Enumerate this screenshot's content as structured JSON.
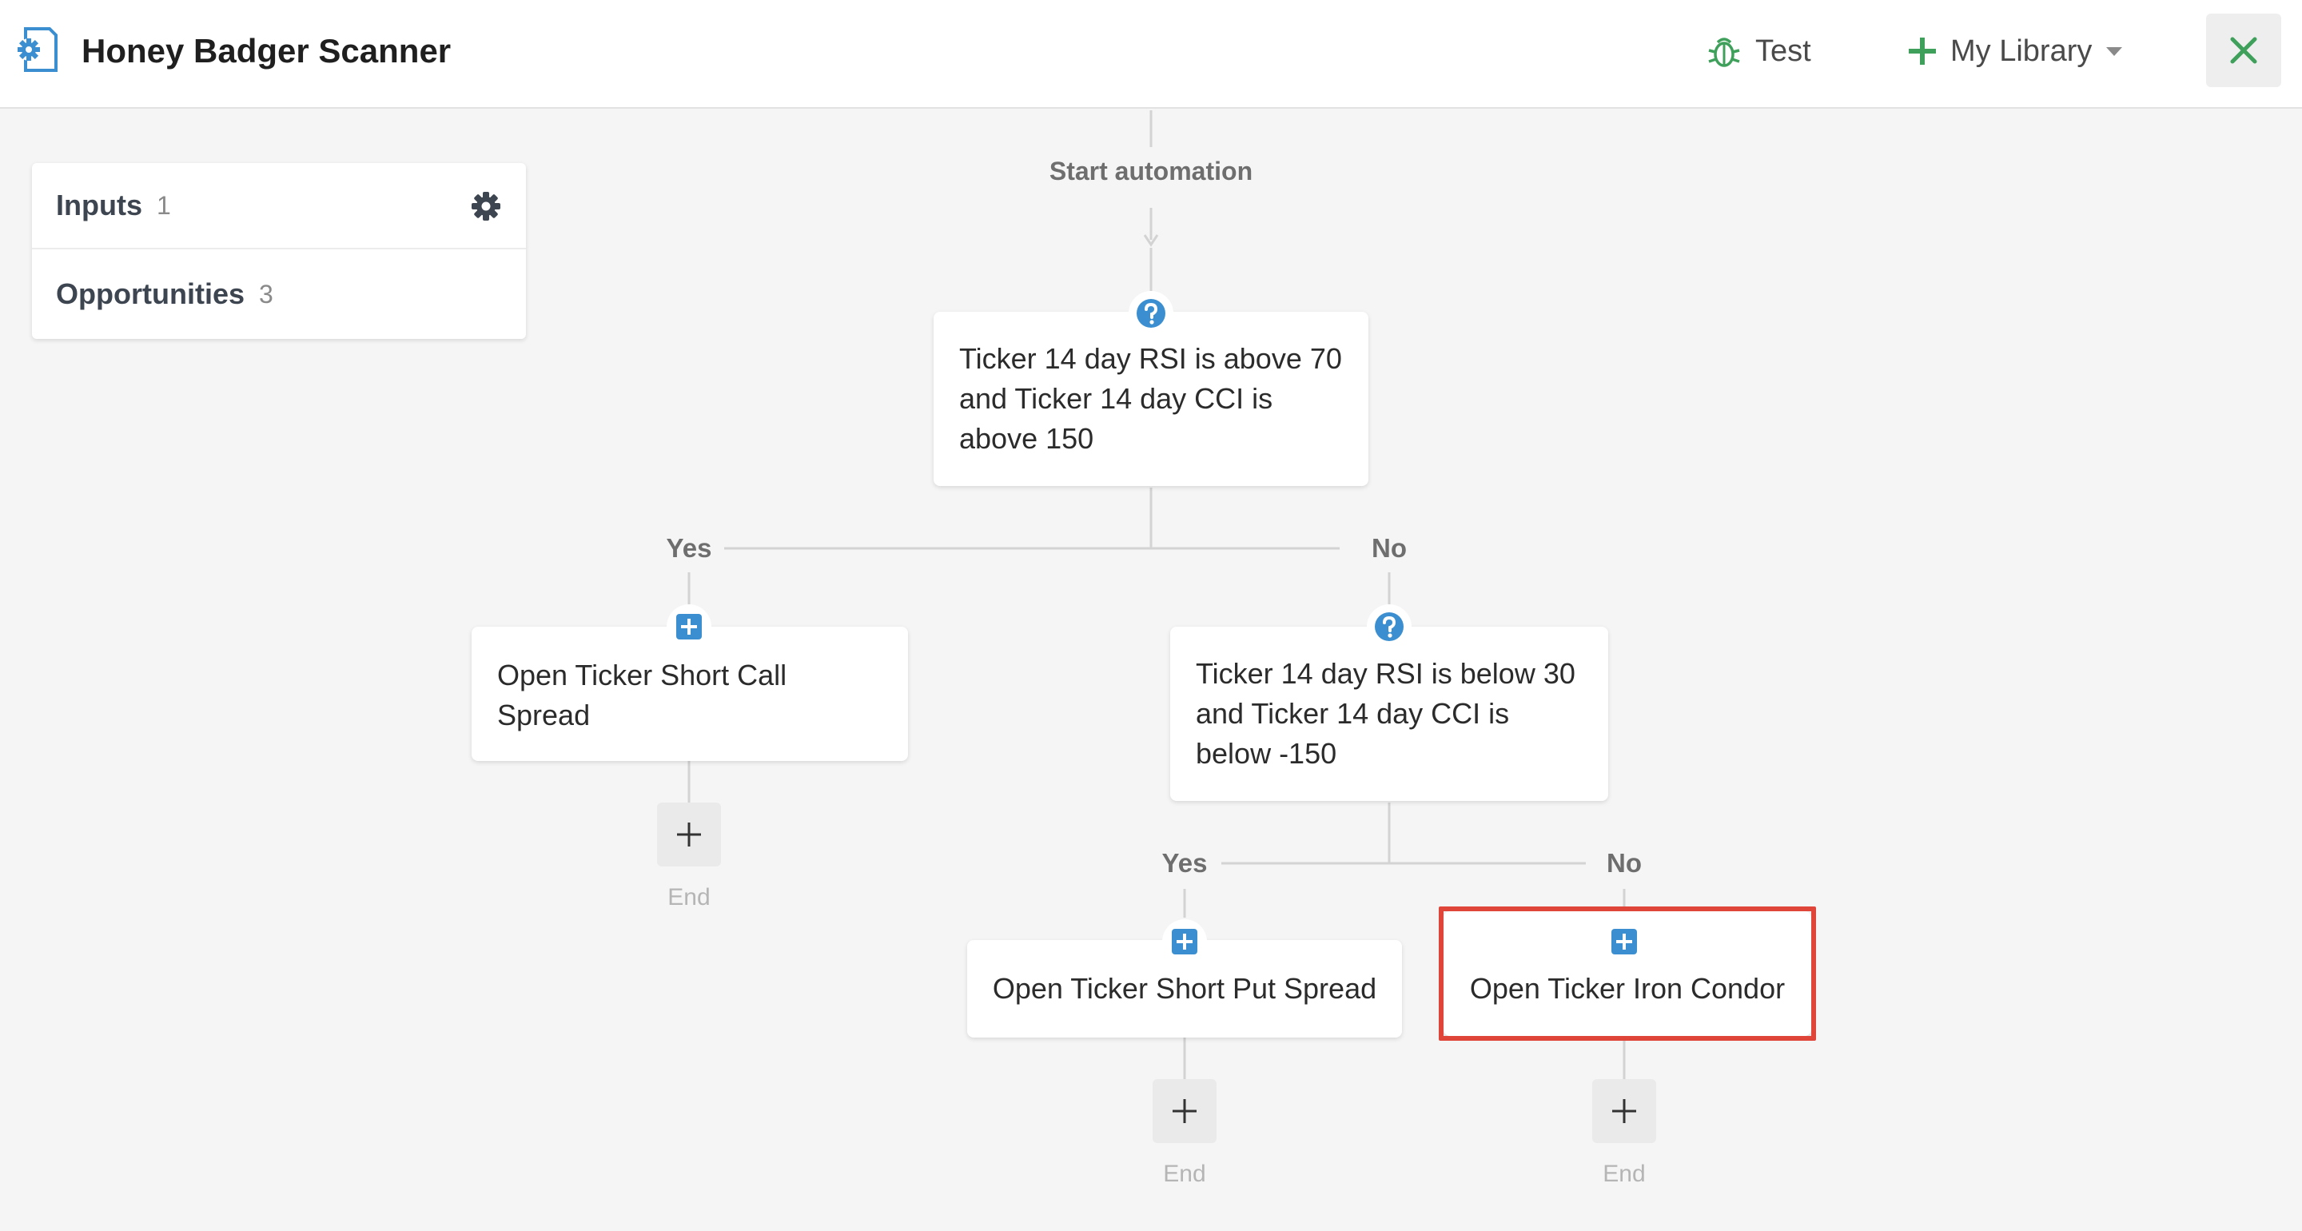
{
  "header": {
    "title": "Honey Badger Scanner",
    "test_label": "Test",
    "library_label": "My Library",
    "accent_color": "#3ea05a"
  },
  "panel": {
    "rows": [
      {
        "name": "Inputs",
        "count": "1"
      },
      {
        "name": "Opportunities",
        "count": "3"
      }
    ]
  },
  "flow": {
    "start_label": "Start automation",
    "condition_1": "Ticker 14 day RSI is above 70 and Ticker 14 day CCI is above 150",
    "branch_1_yes": "Yes",
    "branch_1_no": "No",
    "action_call": "Open Ticker Short Call Spread",
    "condition_2": "Ticker 14 day RSI is below 30 and Ticker 14 day CCI is below -150",
    "branch_2_yes": "Yes",
    "branch_2_no": "No",
    "action_put": "Open Ticker Short Put Spread",
    "action_condor": "Open Ticker Iron Condor",
    "end_label": "End"
  },
  "colors": {
    "icon_blue": "#3b8fd0",
    "highlight_red": "#e0453a",
    "connector": "#d0d0d0"
  }
}
